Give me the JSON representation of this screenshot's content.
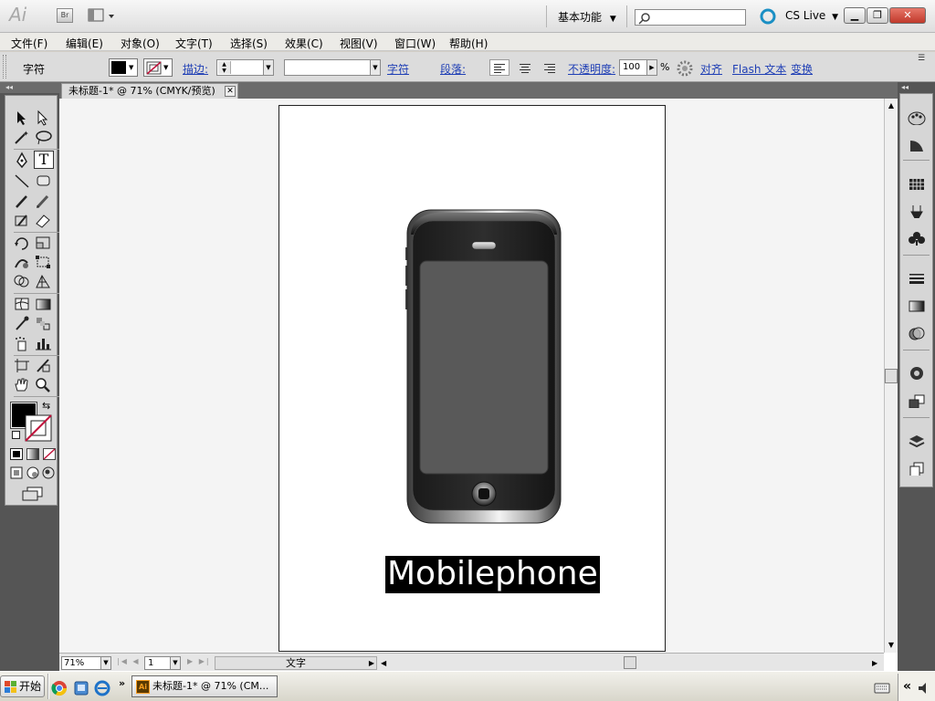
{
  "app": {
    "logo": "Ai",
    "bridge_button": "Br",
    "workspace": "基本功能",
    "cs_live": "CS Live",
    "search_placeholder": ""
  },
  "menu": [
    "文件(F)",
    "编辑(E)",
    "对象(O)",
    "文字(T)",
    "选择(S)",
    "效果(C)",
    "视图(V)",
    "窗口(W)",
    "帮助(H)"
  ],
  "control_bar": {
    "tool_label": "字符",
    "stroke_label": "描边:",
    "char_link": "字符",
    "para_label": "段落:",
    "opacity_label": "不透明度:",
    "opacity_value": "100",
    "opacity_unit": "%",
    "align_link": "对齐",
    "flash_text_link": "Flash 文本",
    "transform_link": "变换",
    "fill_color": "#000000",
    "stroke_color": "none"
  },
  "document": {
    "tab_title": "未标题-1* @ 71% (CMYK/预览)",
    "artwork_text": "Mobilephone"
  },
  "status_bar": {
    "zoom": "71%",
    "page": "1",
    "tool_status": "文字"
  },
  "taskbar": {
    "start": "开始",
    "task": "未标题-1* @ 71% (CM..."
  }
}
